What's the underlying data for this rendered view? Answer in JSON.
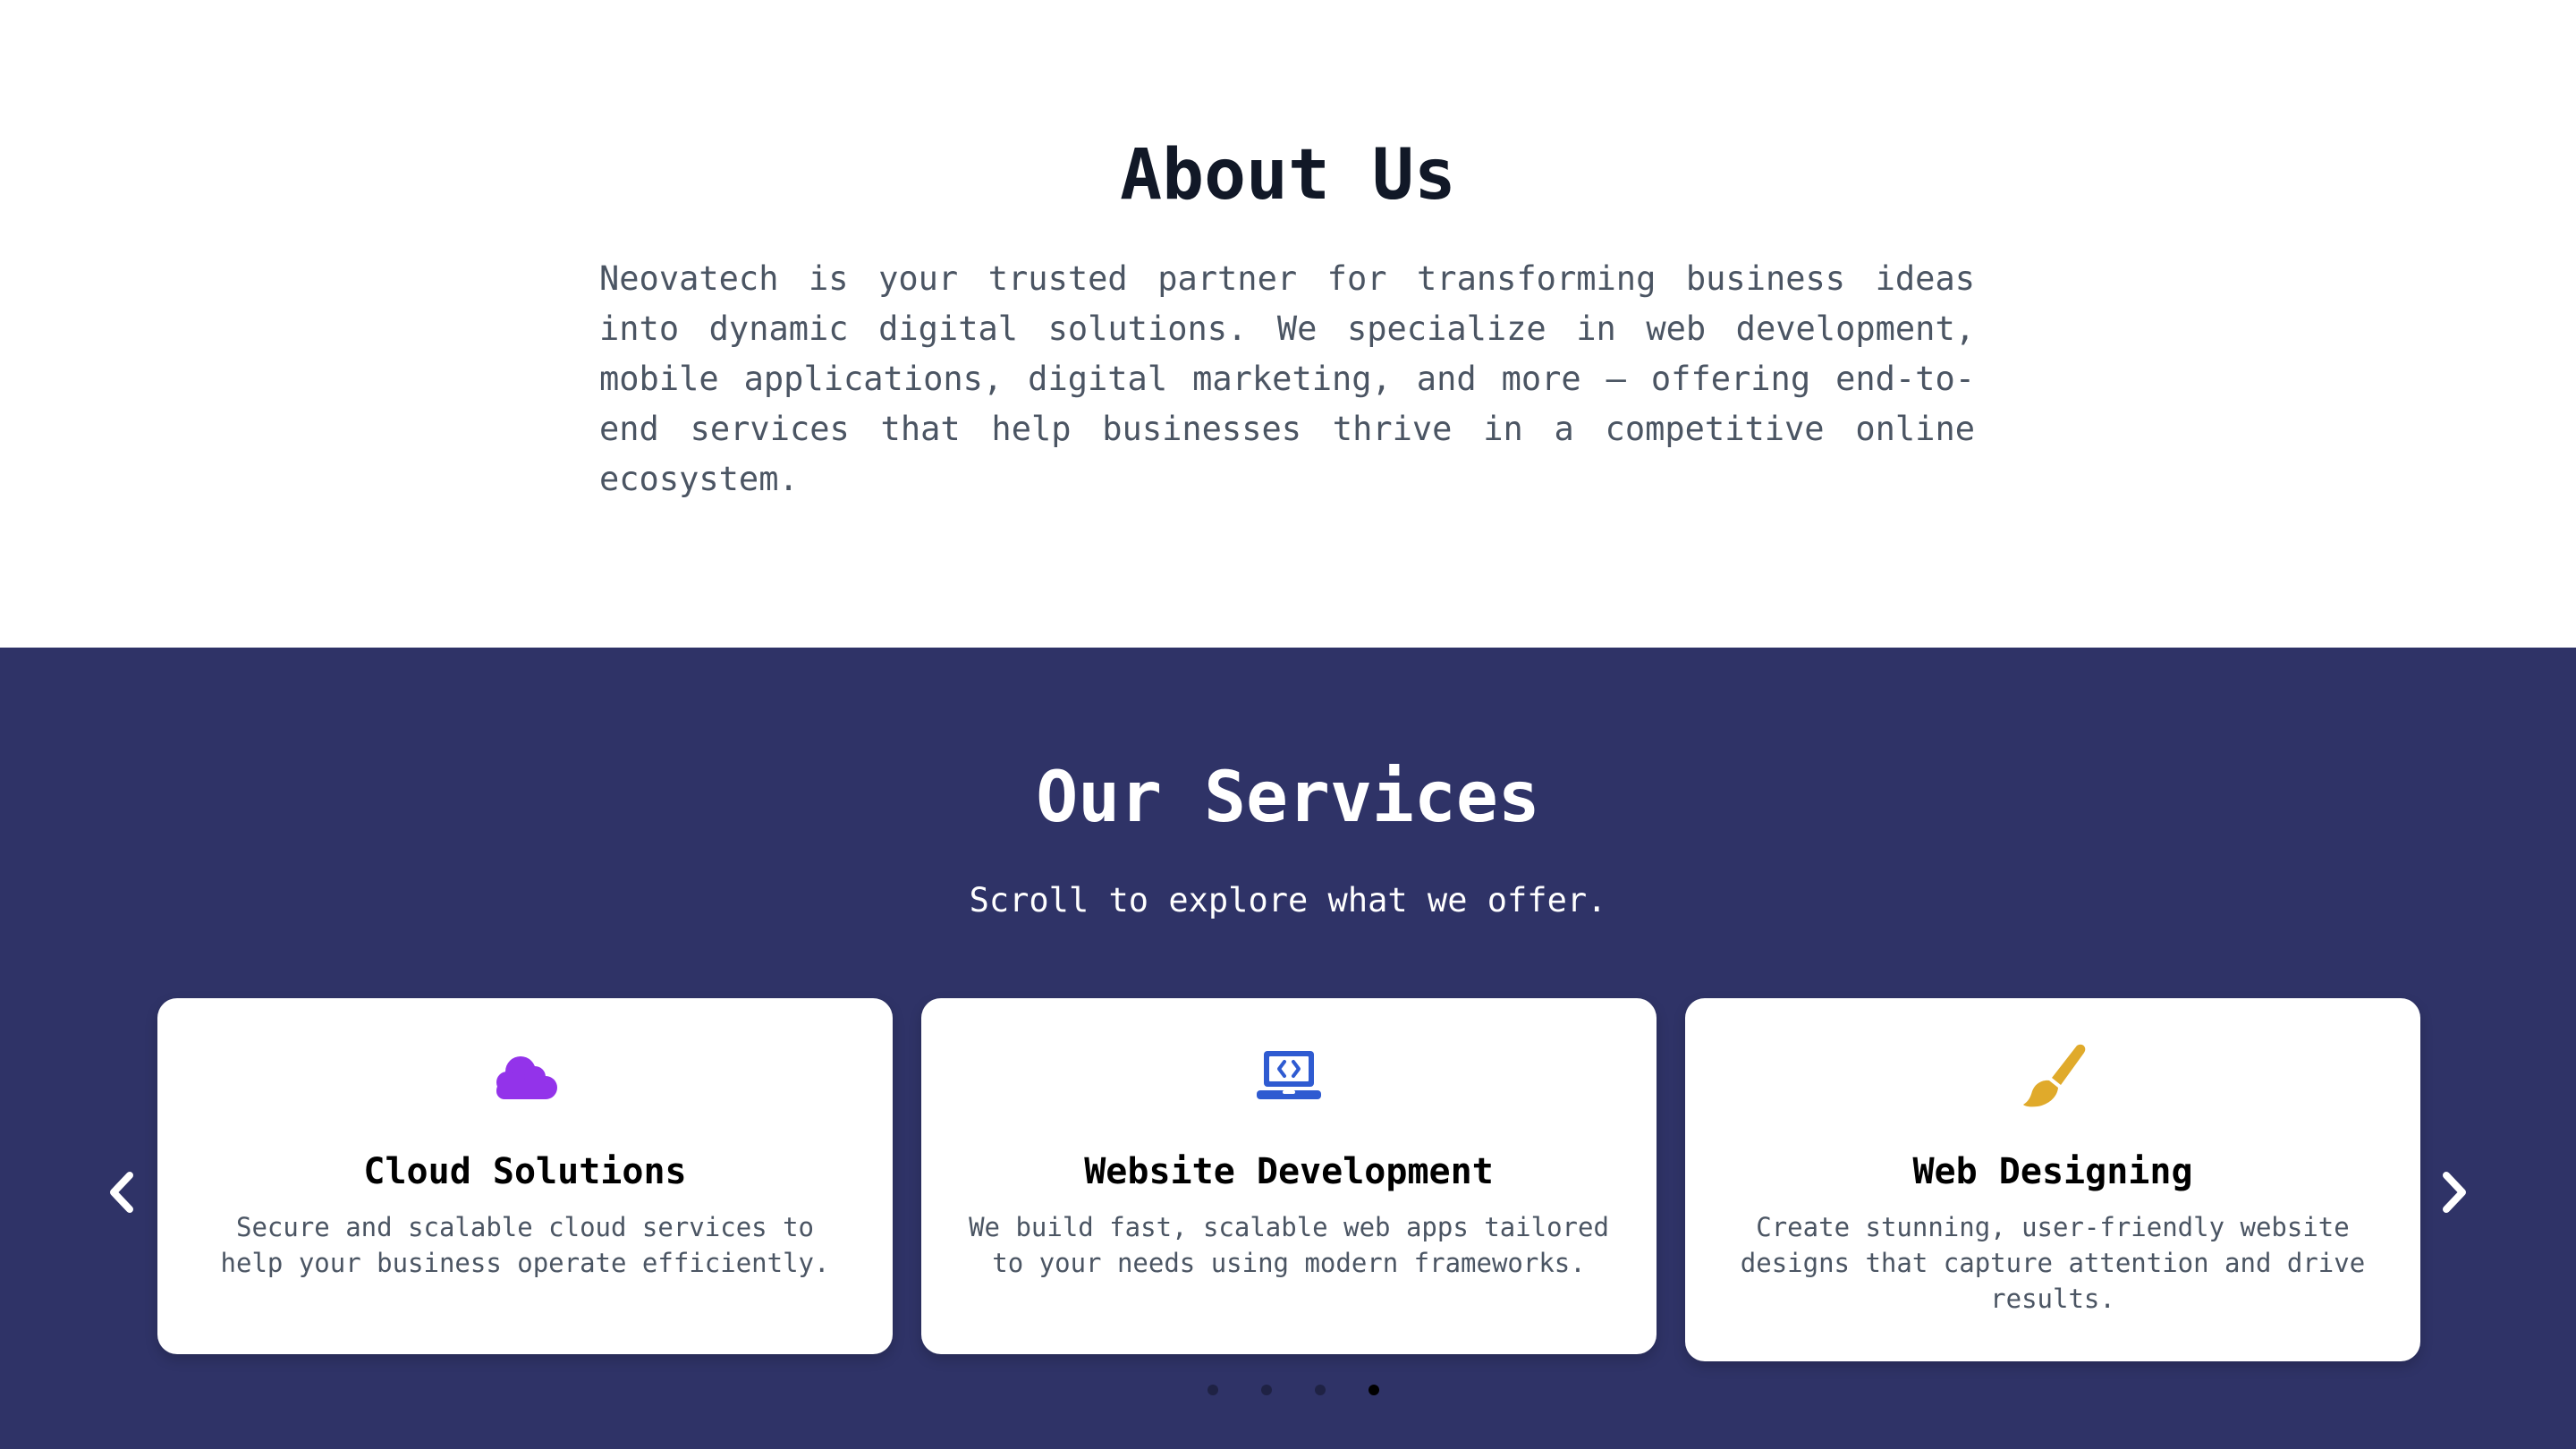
{
  "about": {
    "title": "About Us",
    "text": "Neovatech is your trusted partner for transforming business ideas into dynamic digital solutions. We specialize in web development, mobile applications, digital marketing, and more — offering end-to-end services that help businesses thrive in a competitive online ecosystem."
  },
  "services": {
    "title": "Our Services",
    "subtitle": "Scroll to explore what we offer.",
    "cards": [
      {
        "title": "Cloud Solutions",
        "description": "Secure and scalable cloud services to help your business operate efficiently.",
        "icon": "cloud-icon",
        "icon_color": "#9333ea"
      },
      {
        "title": "Website Development",
        "description": "We build fast, scalable web apps tailored to your needs using modern frameworks.",
        "icon": "laptop-code-icon",
        "icon_color": "#2f5bd1"
      },
      {
        "title": "Web Designing",
        "description": "Create stunning, user-friendly website designs that capture attention and drive results.",
        "icon": "paint-brush-icon",
        "icon_color": "#e0aa2b"
      }
    ],
    "prev_icon": "chevron-left-icon",
    "next_icon": "chevron-right-icon",
    "dots_count": 4,
    "active_dot": 4
  },
  "colors": {
    "services_background": "#2f3367",
    "heading_dark": "#111827",
    "body_text": "#4b5563",
    "card_background": "#ffffff"
  }
}
